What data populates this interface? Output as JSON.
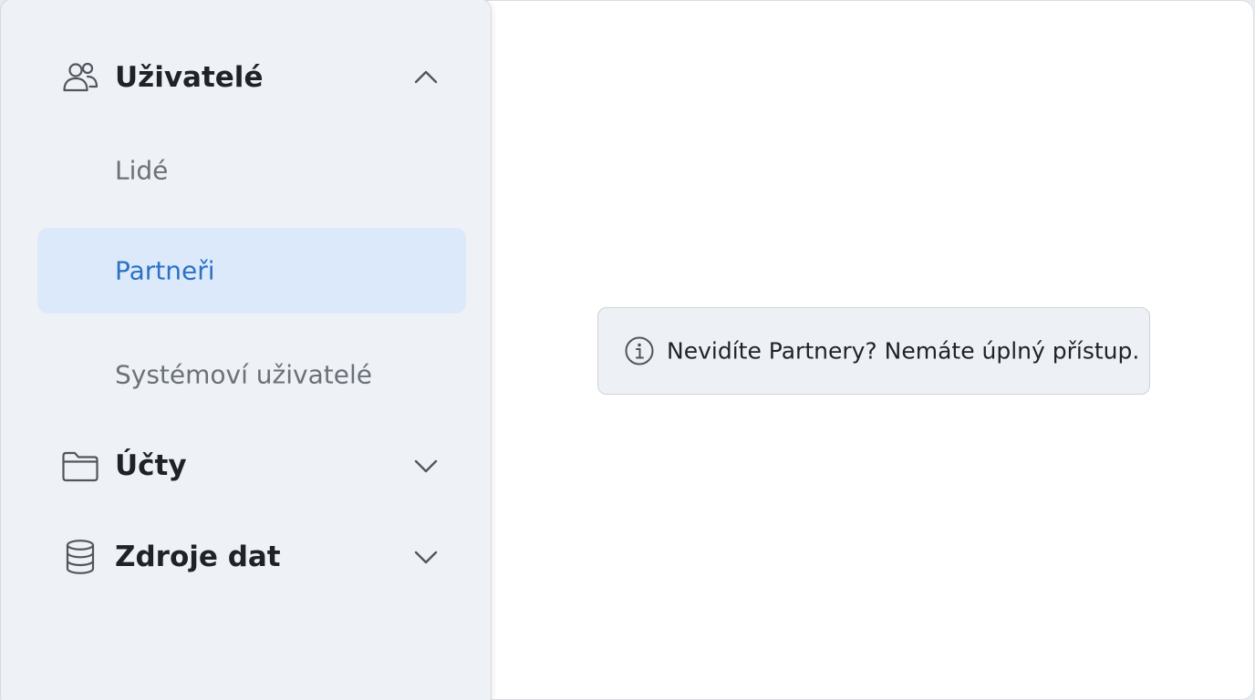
{
  "sidebar": {
    "groups": [
      {
        "label": "Uživatelé",
        "icon": "users-icon",
        "expanded": true,
        "items": [
          {
            "label": "Lidé",
            "active": false
          },
          {
            "label": "Partneři",
            "active": true
          },
          {
            "label": "Systémoví uživatelé",
            "active": false
          }
        ]
      },
      {
        "label": "Účty",
        "icon": "folder-icon",
        "expanded": false
      },
      {
        "label": "Zdroje dat",
        "icon": "database-icon",
        "expanded": false
      }
    ]
  },
  "notice": {
    "icon": "info-icon",
    "text": "Nevidíte Partnery? Nemáte úplný přístup."
  },
  "colors": {
    "active_background": "#dbe9fb",
    "active_text": "#2b72c4",
    "sidebar_background": "#eef1f5",
    "notice_background": "#edf0f4"
  }
}
